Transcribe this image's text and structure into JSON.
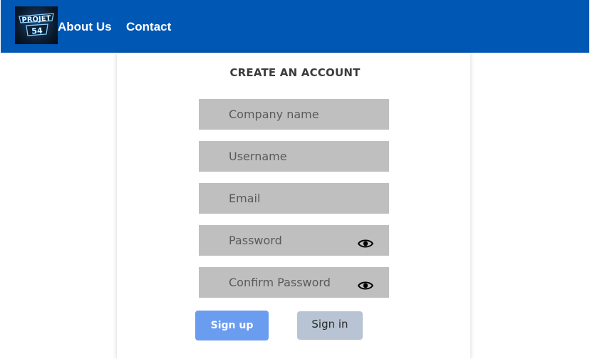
{
  "navbar": {
    "logo": {
      "text_top": "PROJET",
      "text_bottom": "54"
    },
    "links": [
      {
        "label": "About Us"
      },
      {
        "label": "Contact"
      }
    ],
    "color": "#0057b4"
  },
  "form": {
    "title": "CREATE AN ACCOUNT",
    "fields": [
      {
        "placeholder": "Company name",
        "value": ""
      },
      {
        "placeholder": "Username",
        "value": ""
      },
      {
        "placeholder": "Email",
        "value": ""
      },
      {
        "placeholder": "Password",
        "value": "",
        "icon": "eye-icon"
      },
      {
        "placeholder": "Confirm Password",
        "value": "",
        "icon": "eye-icon"
      }
    ],
    "buttons": {
      "signup_label": "Sign up",
      "signin_label": "Sign in"
    }
  },
  "colors": {
    "navbar": "#0057b4",
    "field_bg": "#bfbfbf",
    "signup_bg": "#6a9cf0",
    "signin_bg": "#b8c4d3"
  }
}
